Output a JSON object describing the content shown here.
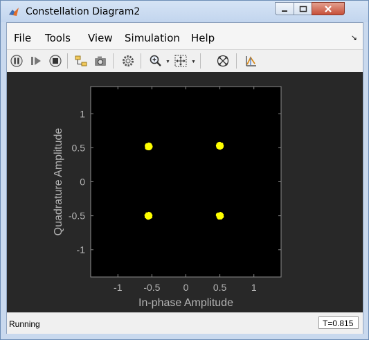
{
  "window": {
    "title": "Constellation Diagram2"
  },
  "menubar": {
    "items": [
      {
        "label": "File",
        "name": "menu-file"
      },
      {
        "label": "Tools",
        "name": "menu-tools"
      },
      {
        "label": "View",
        "name": "menu-view"
      },
      {
        "label": "Simulation",
        "name": "menu-simulation"
      },
      {
        "label": "Help",
        "name": "menu-help"
      }
    ]
  },
  "toolbar": {
    "buttons": [
      "pause-icon",
      "step-forward-icon",
      "stop-icon",
      "signal-selector-icon",
      "snapshot-icon",
      "settings-gear-icon",
      "zoom-in-icon",
      "autoscale-icon",
      "constellation-settings-icon",
      "measurement-icon"
    ]
  },
  "status": {
    "text": "Running",
    "time": "T=0.815"
  },
  "colors": {
    "plot_bg": "#000000",
    "frame_bg": "#282828",
    "points": "#ffff00",
    "axis_text": "#b3b3b3"
  },
  "chart_data": {
    "type": "scatter",
    "xlabel": "In-phase Amplitude",
    "ylabel": "Quadrature Amplitude",
    "xlim": [
      -1.4,
      1.4
    ],
    "ylim": [
      -1.4,
      1.4
    ],
    "xticks": [
      -1,
      -0.5,
      0,
      0.5,
      1
    ],
    "yticks": [
      1,
      0.5,
      0,
      -0.5,
      -1
    ],
    "xtick_labels": [
      "-1",
      "-0.5",
      "0",
      "0.5",
      "1"
    ],
    "ytick_labels": [
      "1",
      "0.5",
      "0",
      "-0.5",
      "-1"
    ],
    "grid": false,
    "clusters": [
      {
        "x": -0.55,
        "y": 0.52
      },
      {
        "x": 0.5,
        "y": 0.53
      },
      {
        "x": -0.55,
        "y": -0.5
      },
      {
        "x": 0.5,
        "y": -0.5
      }
    ],
    "cluster_spread": 0.045
  }
}
